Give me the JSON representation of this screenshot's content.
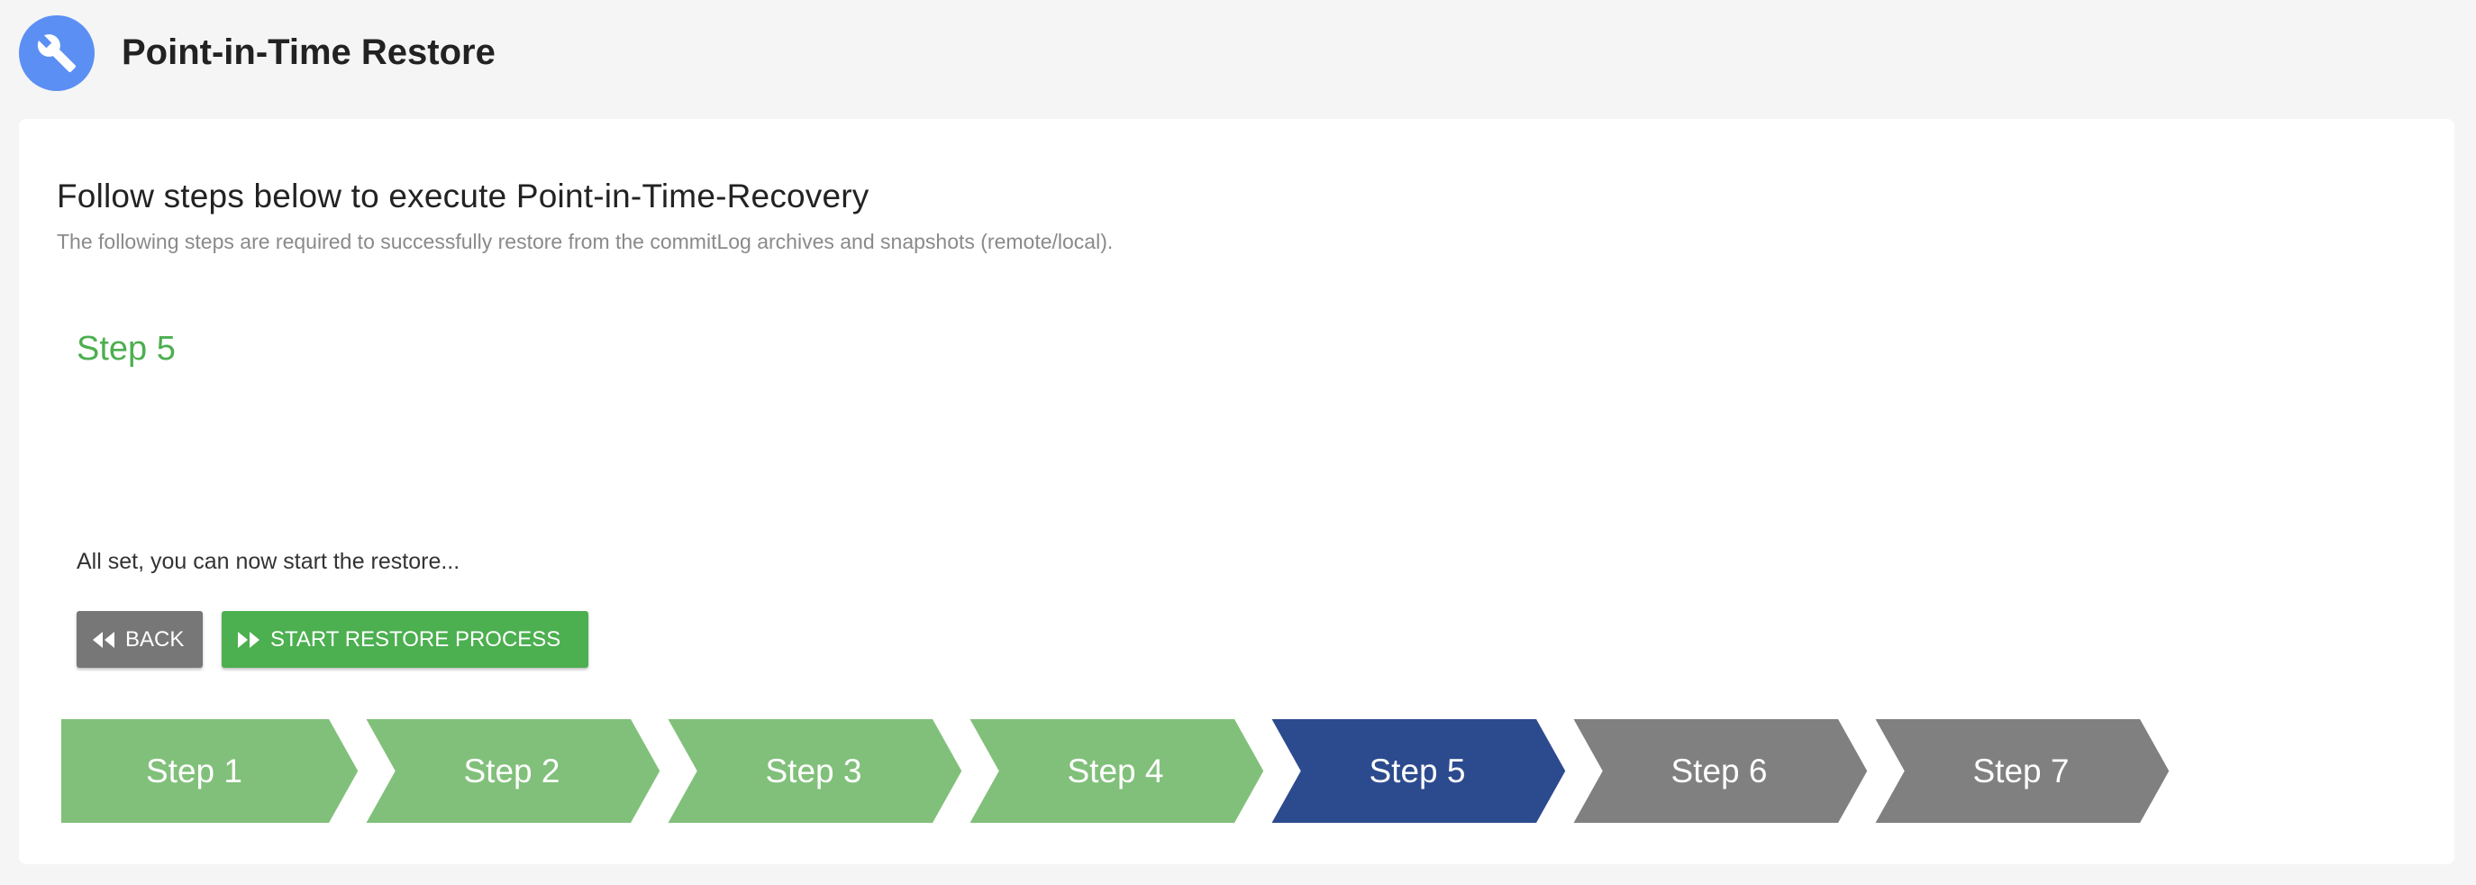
{
  "header": {
    "title": "Point-in-Time Restore",
    "icon": "wrench-icon",
    "icon_bg": "#5b8ff3"
  },
  "card": {
    "heading": "Follow steps below to execute Point-in-Time-Recovery",
    "subheading": "The following steps are required to successfully restore from the commitLog archives and snapshots (remote/local).",
    "step_title": "Step 5",
    "ready_text": "All set, you can now start the restore...",
    "back_label": "BACK",
    "start_label": "START RESTORE PROCESS"
  },
  "stepper": {
    "current": 5,
    "colors": {
      "done": "#81c07a",
      "active": "#2c4a8e",
      "pending": "#808080"
    },
    "steps": [
      {
        "label": "Step 1",
        "state": "done"
      },
      {
        "label": "Step 2",
        "state": "done"
      },
      {
        "label": "Step 3",
        "state": "done"
      },
      {
        "label": "Step 4",
        "state": "done"
      },
      {
        "label": "Step 5",
        "state": "active"
      },
      {
        "label": "Step 6",
        "state": "pending"
      },
      {
        "label": "Step 7",
        "state": "pending"
      }
    ]
  }
}
